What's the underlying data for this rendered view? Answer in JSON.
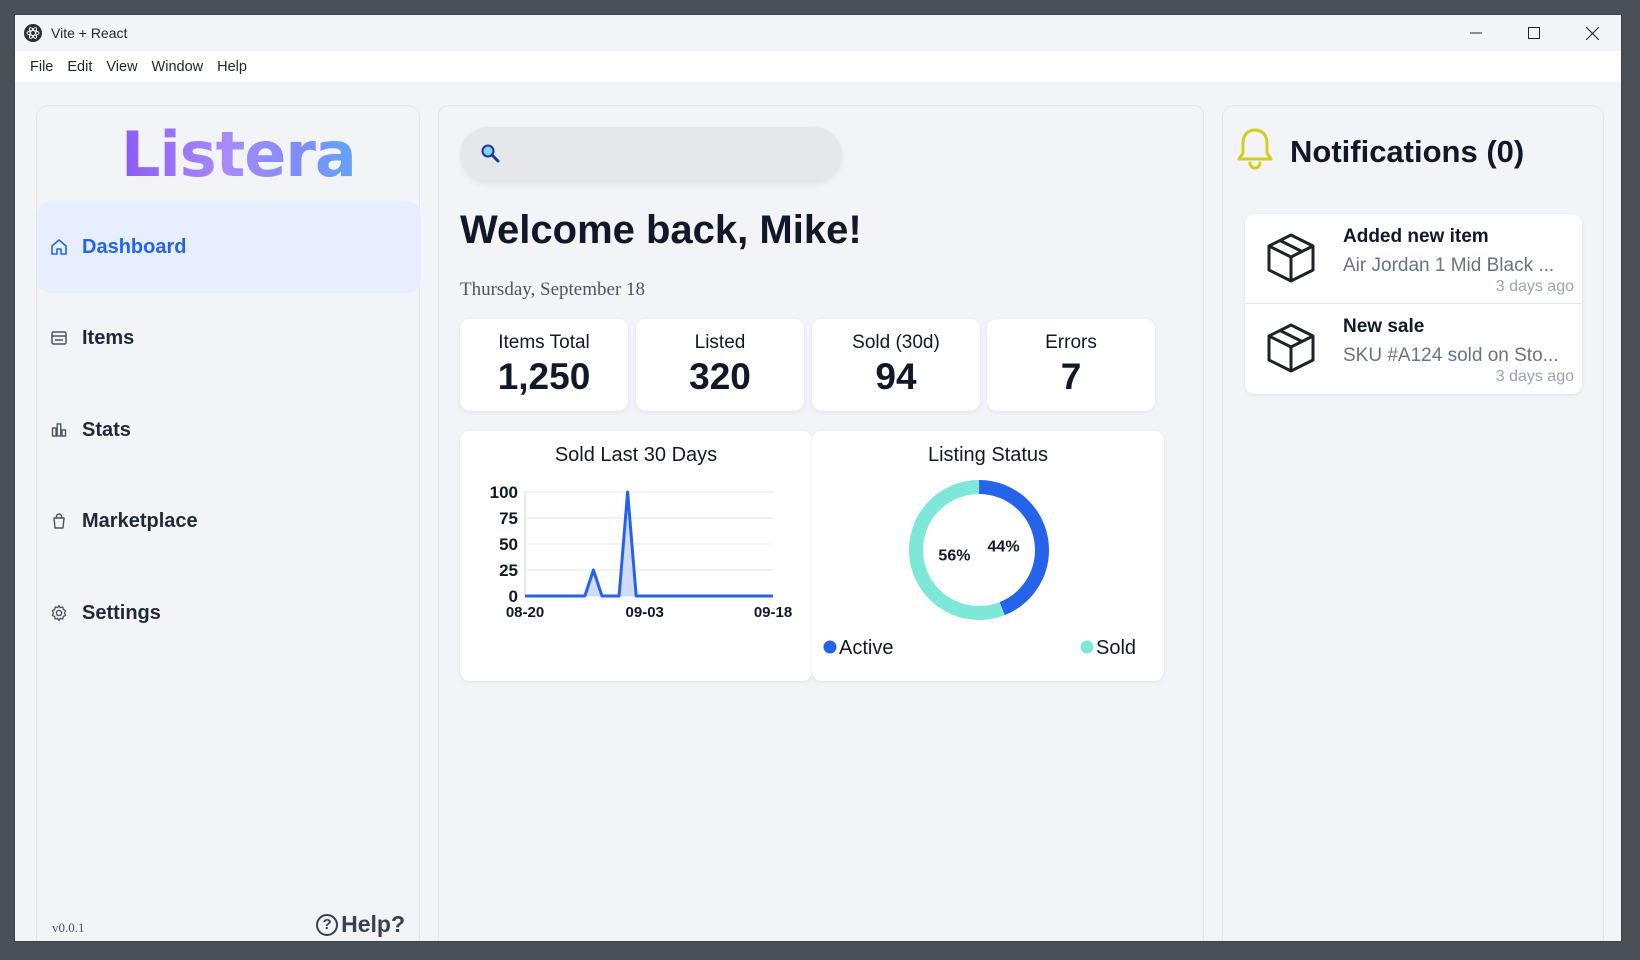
{
  "window": {
    "title": "Vite + React"
  },
  "menu": [
    "File",
    "Edit",
    "View",
    "Window",
    "Help"
  ],
  "sidebar": {
    "logo": "Listera",
    "items": [
      {
        "label": "Dashboard",
        "icon": "home-icon",
        "active": true
      },
      {
        "label": "Items",
        "icon": "list-icon",
        "active": false
      },
      {
        "label": "Stats",
        "icon": "bar-chart-icon",
        "active": false
      },
      {
        "label": "Marketplace",
        "icon": "shopping-bag-icon",
        "active": false
      },
      {
        "label": "Settings",
        "icon": "gear-icon",
        "active": false
      }
    ],
    "version": "v0.0.1",
    "help": "Help?"
  },
  "main": {
    "search": {
      "placeholder": ""
    },
    "welcome": "Welcome back, Mike!",
    "date": "Thursday, September 18",
    "stats": [
      {
        "label": "Items Total",
        "value": "1,250"
      },
      {
        "label": "Listed",
        "value": "320"
      },
      {
        "label": "Sold (30d)",
        "value": "94"
      },
      {
        "label": "Errors",
        "value": "7"
      }
    ]
  },
  "chart_data": [
    {
      "type": "area",
      "title": "Sold Last 30 Days",
      "xlabel": "",
      "ylabel": "",
      "ylim": [
        0,
        100
      ],
      "yticks": [
        "100",
        "75",
        "50",
        "25",
        "0"
      ],
      "xticks": [
        "08-20",
        "09-03",
        "09-18"
      ],
      "x": [
        "08-20",
        "08-21",
        "08-22",
        "08-23",
        "08-24",
        "08-25",
        "08-26",
        "08-27",
        "08-28",
        "08-29",
        "08-30",
        "08-31",
        "09-01",
        "09-02",
        "09-03",
        "09-04",
        "09-05",
        "09-06",
        "09-07",
        "09-08",
        "09-09",
        "09-10",
        "09-11",
        "09-12",
        "09-13",
        "09-14",
        "09-15",
        "09-16",
        "09-17",
        "09-18"
      ],
      "values": [
        0,
        0,
        0,
        0,
        0,
        0,
        0,
        0,
        25,
        0,
        0,
        0,
        100,
        0,
        0,
        0,
        0,
        0,
        0,
        0,
        0,
        0,
        0,
        0,
        0,
        0,
        0,
        0,
        0,
        0
      ],
      "color": "#2563eb",
      "grid": true
    },
    {
      "type": "pie",
      "title": "Listing Status",
      "categories": [
        "Active",
        "Sold"
      ],
      "values": [
        44,
        56
      ],
      "labels": [
        "44%",
        "56%"
      ],
      "colors": [
        "#2563eb",
        "#7ee8d8"
      ],
      "legend": "bottom"
    }
  ],
  "notifications": {
    "title": "Notifications (0)",
    "items": [
      {
        "title": "Added new item",
        "body": "Air Jordan 1 Mid Black ...",
        "time": "3 days ago"
      },
      {
        "title": "New sale",
        "body": "SKU #A124 sold on Sto...",
        "time": "3 days ago"
      }
    ]
  },
  "colors": {
    "accent": "#2563eb",
    "bell": "#d4cc1f",
    "active_nav_bg": "#e6eeff"
  }
}
